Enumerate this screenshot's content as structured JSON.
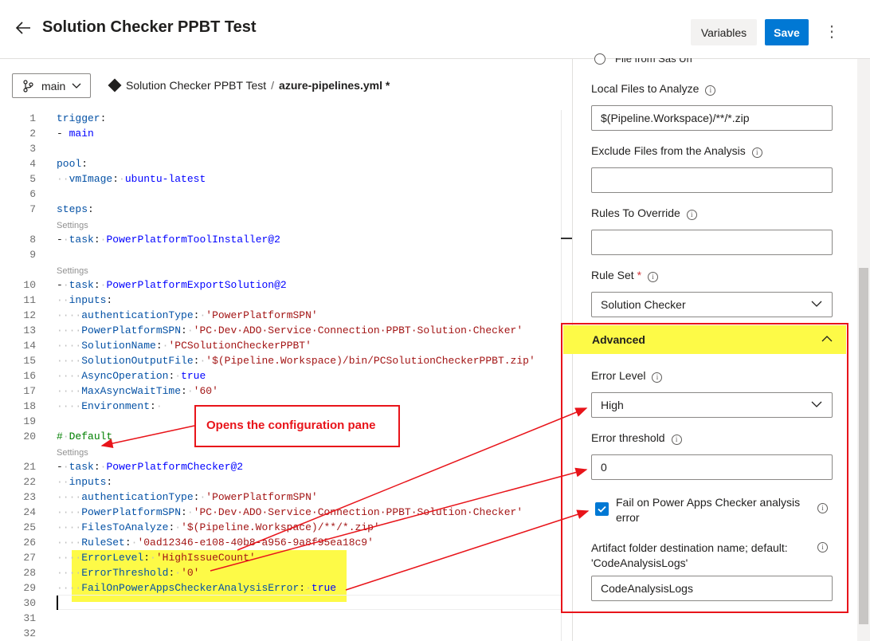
{
  "header": {
    "title": "Solution Checker PPBT Test",
    "variables_label": "Variables",
    "save_label": "Save",
    "more_label": "⋮"
  },
  "editor_bar": {
    "branch": "main",
    "pipeline_name": "Solution Checker PPBT Test",
    "separator": "/",
    "file_name": "azure-pipelines.yml *"
  },
  "code": {
    "settings_label": "Settings"
  },
  "pane": {
    "radio_option": "File from Sas Uri",
    "local_files_label": "Local Files to Analyze",
    "local_files_value": "$(Pipeline.Workspace)/**/*.zip",
    "exclude_label": "Exclude Files from the Analysis",
    "exclude_value": "",
    "override_label": "Rules To Override",
    "override_value": "",
    "ruleset_label": "Rule Set",
    "required_mark": "*",
    "ruleset_value": "Solution Checker",
    "advanced_label": "Advanced",
    "error_level_label": "Error Level",
    "error_level_value": "High",
    "error_threshold_label": "Error threshold",
    "error_threshold_value": "0",
    "fail_checkbox_label": "Fail on Power Apps Checker analysis error",
    "fail_checked": true,
    "artifact_label": "Artifact folder destination name; default: 'CodeAnalysisLogs'",
    "artifact_value": "CodeAnalysisLogs"
  },
  "annotation": {
    "callout_text": "Opens the configuration pane"
  },
  "colors": {
    "accent": "#0078d4",
    "highlight": "#fdfa47",
    "annotation_red": "#e8141a"
  }
}
